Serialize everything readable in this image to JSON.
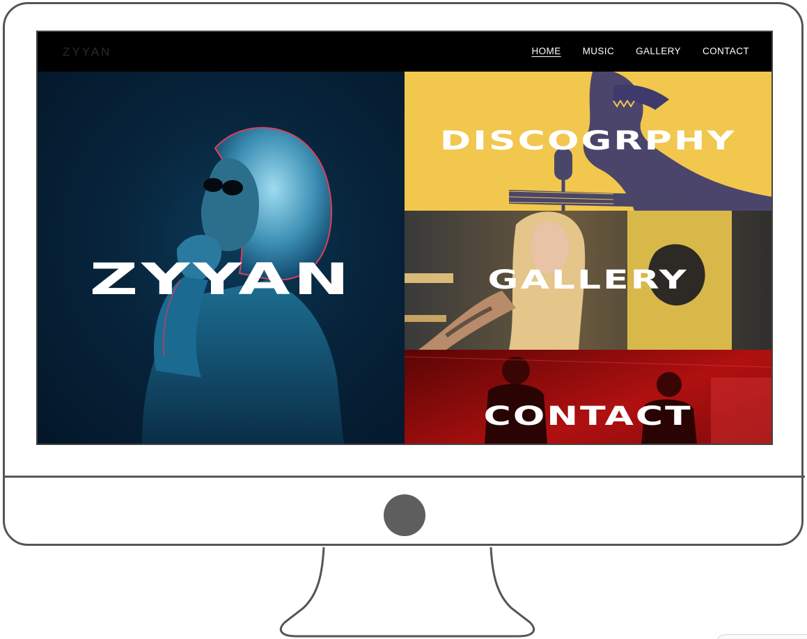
{
  "site": {
    "logo": "ZYYAN",
    "nav": {
      "home": "HOME",
      "music": "MUSIC",
      "gallery": "GALLERY",
      "contact": "CONTACT"
    }
  },
  "hero": {
    "title": "ZYYAN"
  },
  "tiles": {
    "discography": "DISCOGRPHY",
    "gallery": "GALLERY",
    "contact": "CONTACT"
  },
  "colors": {
    "header_bg": "#000000",
    "hero_bg": "#07243b",
    "discography_bg": "#f1c74e",
    "contact_bg": "#8a0a0a",
    "frame": "#555555"
  }
}
